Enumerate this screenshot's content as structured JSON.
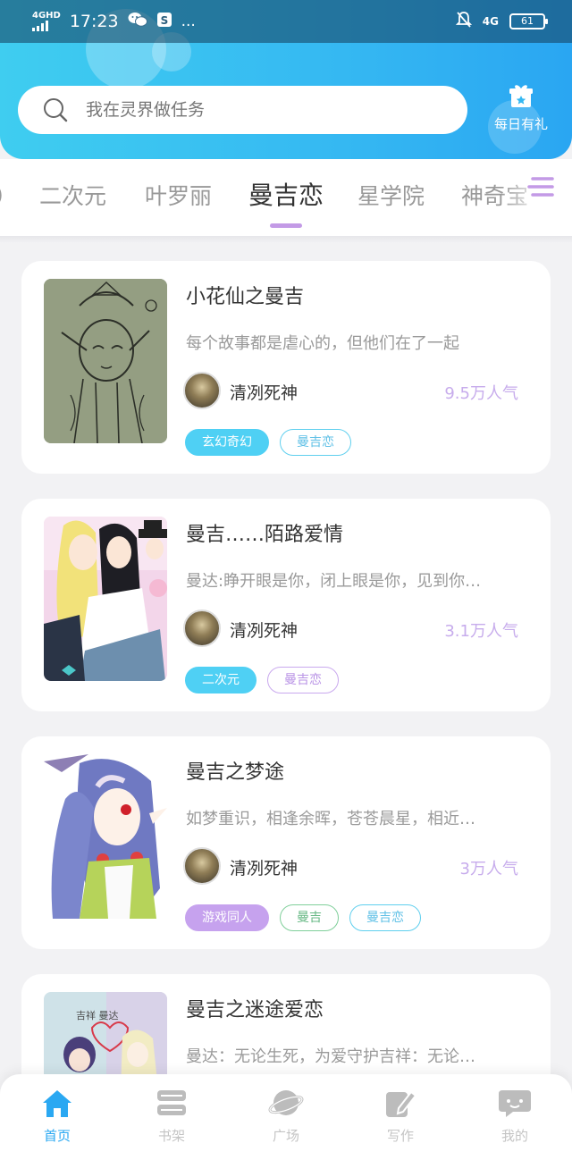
{
  "status_bar": {
    "network": "4GHD",
    "time": "17:23",
    "more": "...",
    "data_type": "4G",
    "battery": "61"
  },
  "header": {
    "search_placeholder": "我在灵界做任务",
    "gift_label": "每日有礼",
    "gift_icon": "gift-icon"
  },
  "tabs": [
    {
      "label": "）",
      "active": false
    },
    {
      "label": "二次元",
      "active": false
    },
    {
      "label": "叶罗丽",
      "active": false
    },
    {
      "label": "曼吉恋",
      "active": true
    },
    {
      "label": "星学院",
      "active": false
    },
    {
      "label": "神奇宝",
      "active": false
    }
  ],
  "accent_colors": {
    "primary": "#35b8f2",
    "indicator": "#c39ae6",
    "popularity": "#c7acec"
  },
  "cards": [
    {
      "title": "小花仙之曼吉",
      "description": "每个故事都是虐心的，但他们在了一起",
      "author": "清冽死神",
      "popularity": "9.5万人气",
      "tags": [
        {
          "label": "玄幻奇幻",
          "style": "fill-blue"
        },
        {
          "label": "曼吉恋",
          "style": "out-blue"
        }
      ]
    },
    {
      "title": "曼吉……陌路爱情",
      "description": "曼达:睁开眼是你，闭上眼是你，见到你…",
      "author": "清冽死神",
      "popularity": "3.1万人气",
      "tags": [
        {
          "label": "二次元",
          "style": "fill-blue"
        },
        {
          "label": "曼吉恋",
          "style": "out-purple"
        }
      ]
    },
    {
      "title": "曼吉之梦途",
      "description": "如梦重识，相逢余晖，苍苍晨星，相近…",
      "author": "清冽死神",
      "popularity": "3万人气",
      "tags": [
        {
          "label": "游戏同人",
          "style": "fill-purple"
        },
        {
          "label": "曼吉",
          "style": "out-green"
        },
        {
          "label": "曼吉恋",
          "style": "out-blue"
        }
      ]
    },
    {
      "title": "曼吉之迷途爱恋",
      "description": "曼达：无论生死，为爱守护吉祥：无论…",
      "cover_text": "吉祥 曼达"
    }
  ],
  "bottom_nav": [
    {
      "label": "首页",
      "icon": "home-icon",
      "active": true
    },
    {
      "label": "书架",
      "icon": "bookshelf-icon",
      "active": false
    },
    {
      "label": "广场",
      "icon": "planet-icon",
      "active": false
    },
    {
      "label": "写作",
      "icon": "pen-icon",
      "active": false
    },
    {
      "label": "我的",
      "icon": "chat-profile-icon",
      "active": false
    }
  ]
}
